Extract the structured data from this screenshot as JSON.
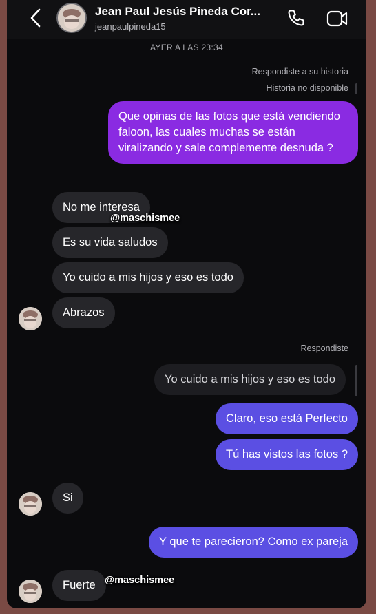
{
  "header": {
    "name": "Jean Paul Jesús Pineda Cor...",
    "username": "jeanpaulpineda15",
    "icons": [
      "back-icon",
      "phone-icon",
      "video-icon"
    ]
  },
  "timestamp": "AYER A LAS 23:34",
  "story_reply": {
    "meta_line1": "Respondiste a su historia",
    "meta_line2": "Historia no disponible"
  },
  "messages": [
    {
      "from": "me",
      "text": "Que opinas de las fotos que está vendiendo faloon, las cuales muchas se están viralizando y sale complemente desnuda ?"
    },
    {
      "from": "them",
      "text": "No me interesa"
    },
    {
      "from": "them",
      "text": "Es su vida saludos"
    },
    {
      "from": "them",
      "text": "Yo cuido a mis hijos y eso es todo"
    },
    {
      "from": "them",
      "text": "Abrazos"
    },
    {
      "from": "me",
      "text": "Claro, eso está Perfecto"
    },
    {
      "from": "me",
      "text": "Tú has vistos las fotos ?"
    },
    {
      "from": "them",
      "text": "Si"
    },
    {
      "from": "me",
      "text": "Y que te parecieron? Como ex pareja"
    },
    {
      "from": "them",
      "text": "Fuerte"
    }
  ],
  "reply": {
    "label": "Respondiste",
    "quoted": "Yo cuido a mis hijos y eso es todo"
  },
  "overlay_tags": [
    "@maschismee",
    "@maschismee"
  ],
  "colors": {
    "purple_bubble": "#8a2be2",
    "blue_bubble": "#5b4fe3",
    "received_bubble": "#26262a",
    "background": "#0b0b0d"
  }
}
